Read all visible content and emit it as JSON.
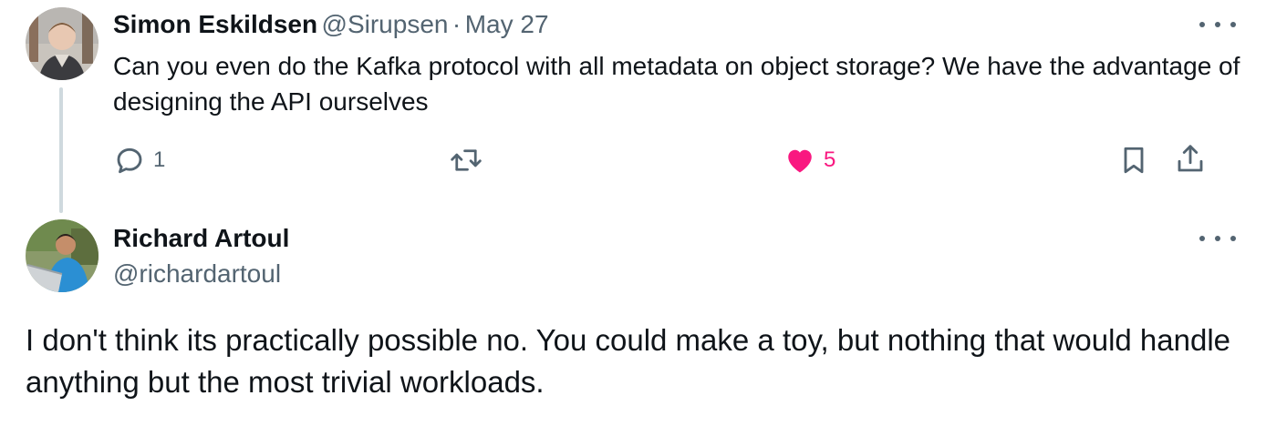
{
  "reply_tweet": {
    "author_name": "Simon Eskildsen",
    "handle": "@Sirupsen",
    "separator": "·",
    "date": "May 27",
    "text": "Can you even do the Kafka protocol with all metadata on object storage? We have the advantage of designing the API ourselves",
    "reply_count": "1",
    "like_count": "5",
    "liked": true,
    "like_color": "#f91880",
    "icons": [
      "reply-icon",
      "retweet-icon",
      "like-icon",
      "bookmark-icon",
      "share-icon",
      "more-icon"
    ]
  },
  "main_tweet": {
    "author_name": "Richard Artoul",
    "handle": "@richardartoul",
    "text": "I don't think its practically possible no. You could make a toy, but nothing that would handle anything but the most trivial workloads.",
    "icons": [
      "more-icon"
    ]
  },
  "colors": {
    "text_primary": "#0f1419",
    "text_secondary": "#536471",
    "thread_line": "#cfd9de",
    "like": "#f91880"
  }
}
